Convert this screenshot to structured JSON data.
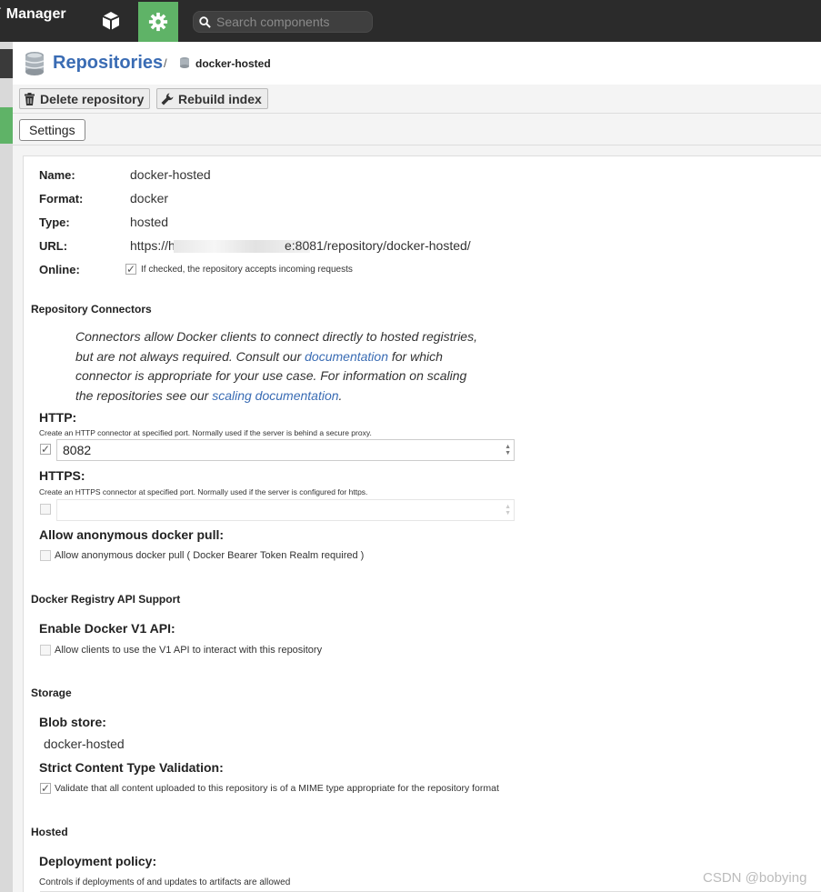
{
  "app": {
    "title": "Manager"
  },
  "search": {
    "placeholder": "Search components"
  },
  "breadcrumb": {
    "root": "Repositories",
    "separator": "/",
    "current": "docker-hosted"
  },
  "toolbar": {
    "delete_label": "Delete repository",
    "rebuild_label": "Rebuild index"
  },
  "tabs": {
    "settings": "Settings"
  },
  "summary": {
    "name_label": "Name:",
    "name_value": "docker-hosted",
    "format_label": "Format:",
    "format_value": "docker",
    "type_label": "Type:",
    "type_value": "hosted",
    "url_label": "URL:",
    "url_prefix": "https://h",
    "url_suffix": "e:8081/repository/docker-hosted/",
    "online_label": "Online:",
    "online_help": "If checked, the repository accepts incoming requests",
    "online_checked": true
  },
  "connectors": {
    "section_title": "Repository Connectors",
    "note_1": "Connectors allow Docker clients to connect directly to hosted registries, but are not always required. Consult our ",
    "note_link_1": "documentation",
    "note_2": " for which connector is appropriate for your use case. For information on scaling the repositories see our ",
    "note_link_2": "scaling documentation",
    "note_3": ".",
    "http_title": "HTTP:",
    "http_help": "Create an HTTP connector at specified port. Normally used if the server is behind a secure proxy.",
    "http_value": "8082",
    "http_checked": true,
    "https_title": "HTTPS:",
    "https_help": "Create an HTTPS connector at specified port. Normally used if the server is configured for https.",
    "https_value": "",
    "https_checked": false,
    "anon_title": "Allow anonymous docker pull:",
    "anon_label": "Allow anonymous docker pull ( Docker Bearer Token Realm required )",
    "anon_checked": false
  },
  "api": {
    "section_title": "Docker Registry API Support",
    "v1_title": "Enable Docker V1 API:",
    "v1_label": "Allow clients to use the V1 API to interact with this repository",
    "v1_checked": false
  },
  "storage": {
    "section_title": "Storage",
    "blob_title": "Blob store:",
    "blob_value": "docker-hosted",
    "strict_title": "Strict Content Type Validation:",
    "strict_label": "Validate that all content uploaded to this repository is of a MIME type appropriate for the repository format",
    "strict_checked": true
  },
  "hosted": {
    "section_title": "Hosted",
    "deploy_title": "Deployment policy:",
    "deploy_help": "Controls if deployments of and updates to artifacts are allowed"
  },
  "watermark": "CSDN @bobying",
  "colors": {
    "accent": "#3a6cb4",
    "admin_active": "#5fb367",
    "topbar": "#2b2b2b"
  }
}
